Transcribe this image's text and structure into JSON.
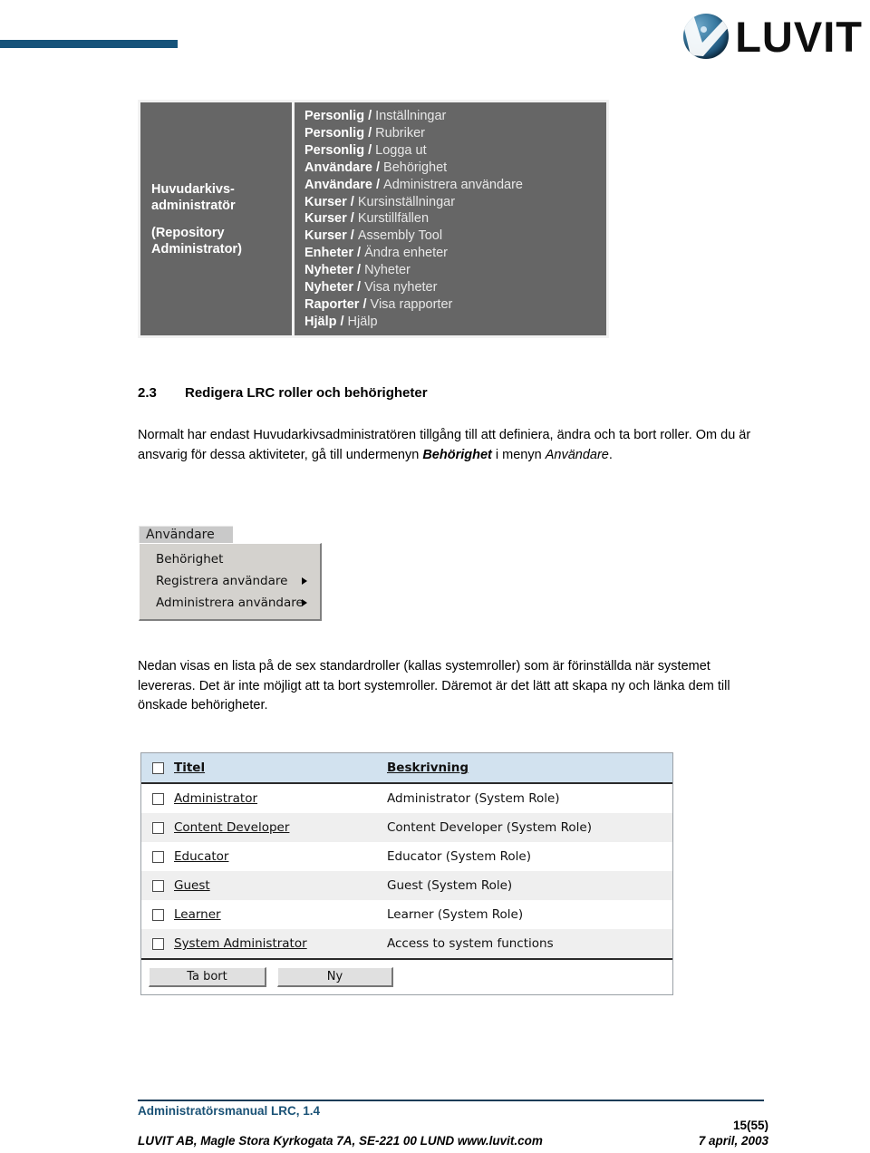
{
  "header": {
    "logo_text": "LUVIT",
    "logo_icon": "luvit-globe-logo",
    "band_color": "#16537a"
  },
  "role_matrix": {
    "role_name_line1": "Huvudarkivs-",
    "role_name_line2": "administratör",
    "role_name_line3": "(Repository",
    "role_name_line4": "Administrator)",
    "permissions": [
      {
        "menu": "Personlig",
        "item": "Inställningar"
      },
      {
        "menu": "Personlig",
        "item": "Rubriker"
      },
      {
        "menu": "Personlig",
        "item": "Logga ut"
      },
      {
        "menu": "Användare",
        "item": "Behörighet"
      },
      {
        "menu": "Användare",
        "item": "Administrera användare"
      },
      {
        "menu": "Kurser",
        "item": "Kursinställningar"
      },
      {
        "menu": "Kurser",
        "item": "Kurstillfällen"
      },
      {
        "menu": "Kurser",
        "item": "Assembly Tool"
      },
      {
        "menu": "Enheter",
        "item": "Ändra enheter"
      },
      {
        "menu": "Nyheter",
        "item": "Nyheter"
      },
      {
        "menu": "Nyheter",
        "item": "Visa nyheter"
      },
      {
        "menu": "Raporter",
        "item": "Visa rapporter"
      },
      {
        "menu": "Hjälp",
        "item": "Hjälp"
      }
    ],
    "separator": " / ",
    "background_color": "#666666"
  },
  "section": {
    "number": "2.3",
    "title": "Redigera LRC roller och behörigheter"
  },
  "paragraph_1": {
    "part_1": "Normalt har endast Huvudarkivsadministratören tillgång till att definiera, ändra och ta bort roller. Om du är ansvarig för dessa aktiviteter, gå till undermenyn ",
    "emphasis_1": "Behörighet",
    "part_2": " i menyn ",
    "emphasis_2": "Användare",
    "part_3": "."
  },
  "menu_screenshot": {
    "tab_label": "Användare",
    "items": [
      {
        "label": "Behörighet",
        "has_submenu": false
      },
      {
        "label": "Registrera användare",
        "has_submenu": true
      },
      {
        "label": "Administrera användare",
        "has_submenu": true
      }
    ]
  },
  "paragraph_2": {
    "text": "Nedan visas en lista på de sex standardroller (kallas systemroller) som är förinställda när systemet levereras. Det är inte möjligt att ta bort systemroller. Däremot är det lätt att skapa ny och länka dem till önskade behörigheter."
  },
  "roles_table": {
    "columns": [
      "Titel",
      "Beskrivning"
    ],
    "rows": [
      {
        "title": "Administrator",
        "description": "Administrator (System Role)"
      },
      {
        "title": "Content Developer",
        "description": "Content Developer (System Role)"
      },
      {
        "title": "Educator",
        "description": "Educator (System Role)"
      },
      {
        "title": "Guest",
        "description": "Guest (System Role)"
      },
      {
        "title": "Learner",
        "description": "Learner (System Role)"
      },
      {
        "title": "System Administrator",
        "description": "Access to system functions"
      }
    ],
    "buttons": {
      "delete": "Ta bort",
      "new": "Ny"
    },
    "header_background": "#d2e2ef"
  },
  "footer": {
    "manual_title": "Administratörsmanual LRC, 1.4",
    "address": "LUVIT AB, Magle Stora Kyrkogata 7A, SE-221 00  LUND www.luvit.com",
    "page": "15(55)",
    "date": "7 april, 2003",
    "title_color": "#1a5276"
  }
}
